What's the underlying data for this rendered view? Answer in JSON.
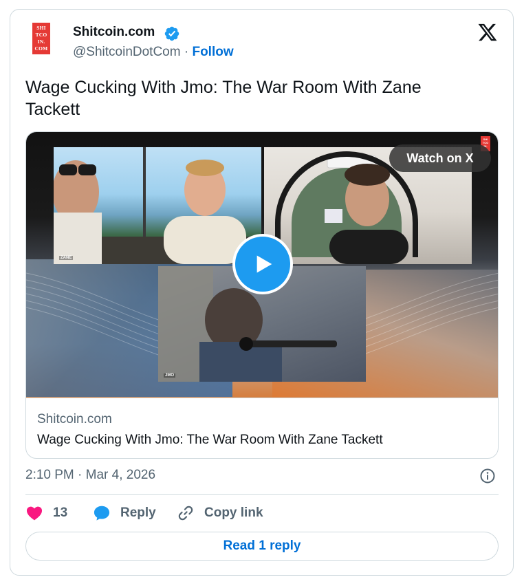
{
  "author": {
    "display_name": "Shitcoin.com",
    "handle": "@ShitcoinDotCom",
    "separator": " · ",
    "follow_label": "Follow",
    "avatar_lines": [
      "SHI",
      "TCO",
      "IN.",
      "COM"
    ]
  },
  "tweet": {
    "text": "Wage Cucking With Jmo: The War Room With Zane Tackett",
    "timestamp": "2:10 PM · Mar 4, 2026"
  },
  "media": {
    "watch_label": "Watch on X",
    "domain": "Shitcoin.com",
    "title": "Wage Cucking With Jmo: The War Room With Zane Tackett",
    "frame_labels": [
      "ZANE",
      "JMO"
    ]
  },
  "actions": {
    "like_count": "13",
    "reply_label": "Reply",
    "copy_link_label": "Copy link",
    "read_replies_label": "Read 1 reply"
  },
  "icons": {
    "verified": "verified-badge-icon",
    "x_logo": "x-logo-icon",
    "info": "info-icon",
    "like": "heart-icon",
    "reply": "speech-bubble-icon",
    "copy": "link-icon",
    "play": "play-icon"
  },
  "colors": {
    "accent_blue": "#1d9bf0",
    "link_blue": "#006fd6",
    "like_pink": "#f91880",
    "muted_text": "#536471",
    "border": "#cfd9de",
    "brand_red": "#e53935"
  }
}
